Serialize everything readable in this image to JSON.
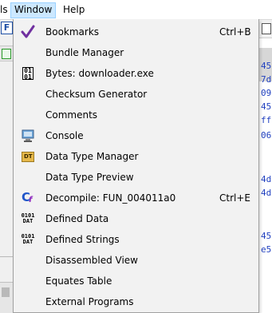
{
  "menubar": {
    "partial_left": "ls",
    "window": "Window",
    "help": "Help"
  },
  "background": {
    "left_glyph": "F",
    "hex_values": [
      "45",
      "7d",
      "09",
      "45",
      "ff",
      "06",
      "4d",
      "4d",
      "45",
      "e5"
    ]
  },
  "menu": {
    "items": [
      {
        "label": "Bookmarks",
        "shortcut": "Ctrl+B",
        "icon": "checkmark-icon"
      },
      {
        "label": "Bundle Manager",
        "shortcut": "",
        "icon": ""
      },
      {
        "label": "Bytes: downloader.exe",
        "shortcut": "",
        "icon": "binary-icon"
      },
      {
        "label": "Checksum Generator",
        "shortcut": "",
        "icon": ""
      },
      {
        "label": "Comments",
        "shortcut": "",
        "icon": ""
      },
      {
        "label": "Console",
        "shortcut": "",
        "icon": "monitor-icon"
      },
      {
        "label": "Data Type Manager",
        "shortcut": "",
        "icon": "folder-dt-icon"
      },
      {
        "label": "Data Type Preview",
        "shortcut": "",
        "icon": ""
      },
      {
        "label": "Decompile: FUN_004011a0",
        "shortcut": "Ctrl+E",
        "icon": "decompile-icon"
      },
      {
        "label": "Defined Data",
        "shortcut": "",
        "icon": "dat-icon"
      },
      {
        "label": "Defined Strings",
        "shortcut": "",
        "icon": "dat-icon"
      },
      {
        "label": "Disassembled View",
        "shortcut": "",
        "icon": ""
      },
      {
        "label": "Equates Table",
        "shortcut": "",
        "icon": ""
      },
      {
        "label": "External Programs",
        "shortcut": "",
        "icon": ""
      }
    ],
    "dat_icon_top": "0101",
    "dat_icon_bottom": "DAT",
    "binary_icon_text": "01",
    "decompile_icon_letter": "C",
    "decompile_icon_sub": "f",
    "dt_icon_text": "DT"
  },
  "colors": {
    "menu_bg": "#f2f2f2",
    "active_menu_bg": "#cce8ff",
    "check": "#7030a0",
    "hex_text": "#1f3fbf"
  }
}
